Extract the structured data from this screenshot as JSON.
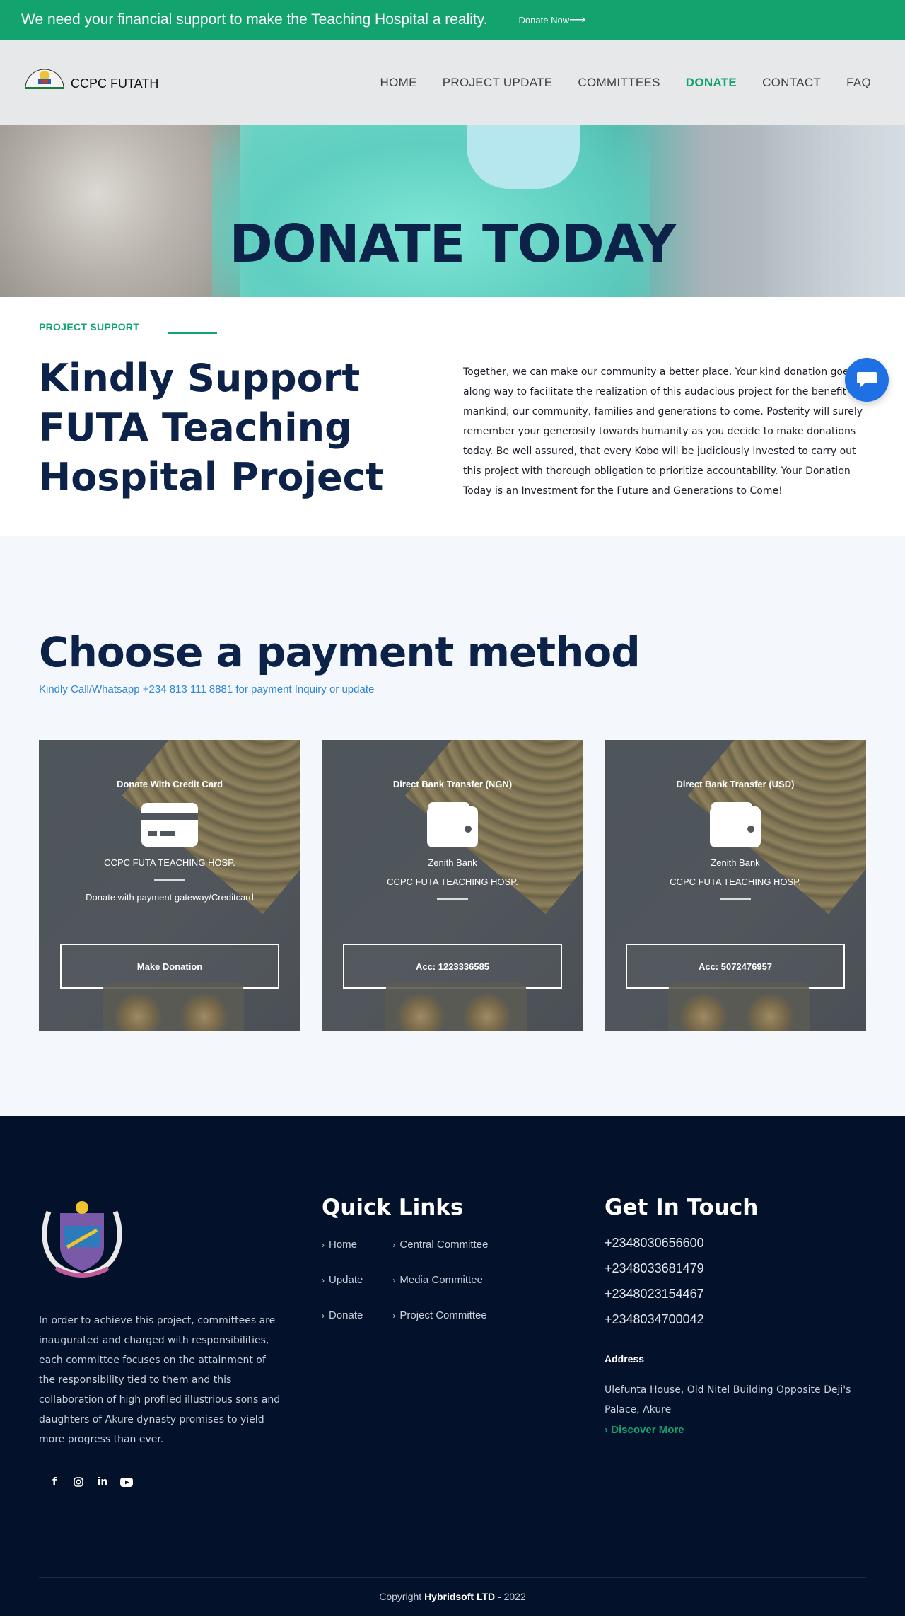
{
  "topbar": {
    "message": "We need your financial support to make the Teaching Hospital a reality.",
    "cta_label": "Donate Now",
    "cta_arrow": "⟶"
  },
  "header": {
    "logo_text": "CCPC FUTATH",
    "nav": [
      {
        "label": "HOME",
        "active": false
      },
      {
        "label": "PROJECT UPDATE",
        "active": false
      },
      {
        "label": "COMMITTEES",
        "active": false
      },
      {
        "label": "DONATE",
        "active": true
      },
      {
        "label": "CONTACT",
        "active": false
      },
      {
        "label": "FAQ",
        "active": false
      }
    ]
  },
  "hero": {
    "title": "DONATE TODAY"
  },
  "intro": {
    "eyebrow": "PROJECT SUPPORT",
    "heading_lines": [
      "Kindly Support",
      "FUTA Teaching",
      "Hospital Project"
    ],
    "body": "Together, we can make our community a better place. Your kind donation goes along way to facilitate the realization of this audacious project for the benefit of mankind; our community, families and generations to come. Posterity will surely remember your generosity towards humanity as you decide to make donations today. Be well assured, that every Kobo will be judiciously invested to carry out this project with thorough obligation to prioritize accountability. Your Donation Today is an Investment for the Future and Generations to Come!"
  },
  "payment": {
    "heading": "Choose a payment method",
    "inquiry": "Kindly Call/Whatsapp +234 813 111 8881 for payment Inquiry or update",
    "cards": [
      {
        "title": "Donate With Credit Card",
        "icon": "credit-card-icon",
        "line1": "CCPC FUTA TEACHING HOSP.",
        "line2": "Donate with payment gateway/Creditcard",
        "button": "Make Donation"
      },
      {
        "title": "Direct Bank Transfer (NGN)",
        "icon": "wallet-icon",
        "line1": "Zenith Bank",
        "line2": "CCPC FUTA TEACHING HOSP.",
        "button": "Acc: 1223336585"
      },
      {
        "title": "Direct Bank Transfer (USD)",
        "icon": "wallet-icon",
        "line1": "Zenith Bank",
        "line2": "CCPC FUTA TEACHING HOSP.",
        "button": "Acc: 5072476957"
      }
    ]
  },
  "footer": {
    "about": "In order to achieve this project, committees are inaugurated and charged with responsibilities, each committee focuses on the attainment of the responsibility tied to them and this collaboration of high profiled illustrious sons and daughters of Akure dynasty promises to yield more progress than ever.",
    "socials": [
      "facebook-icon",
      "instagram-icon",
      "linkedin-icon",
      "youtube-icon"
    ],
    "quick_links_heading": "Quick Links",
    "quick_links_col1": [
      "Home",
      "Update",
      "Donate"
    ],
    "quick_links_col2": [
      "Central Committee",
      "Media Committee",
      "Project Committee"
    ],
    "contact_heading": "Get In Touch",
    "phones": [
      "+2348030656600",
      "+2348033681479",
      "+2348023154467",
      "+2348034700042"
    ],
    "address_heading": "Address",
    "address": "Ulefunta House, Old Nitel Building Opposite Deji's Palace, Akure",
    "discover": "Discover More",
    "copyright_prefix": "Copyright",
    "copyright_company": "Hybridsoft LTD",
    "copyright_suffix": "- 2022"
  },
  "colors": {
    "brand_green": "#13a36f",
    "navy": "#0c2248",
    "footer_bg": "#04112a",
    "chat_blue": "#1f6fe5"
  }
}
